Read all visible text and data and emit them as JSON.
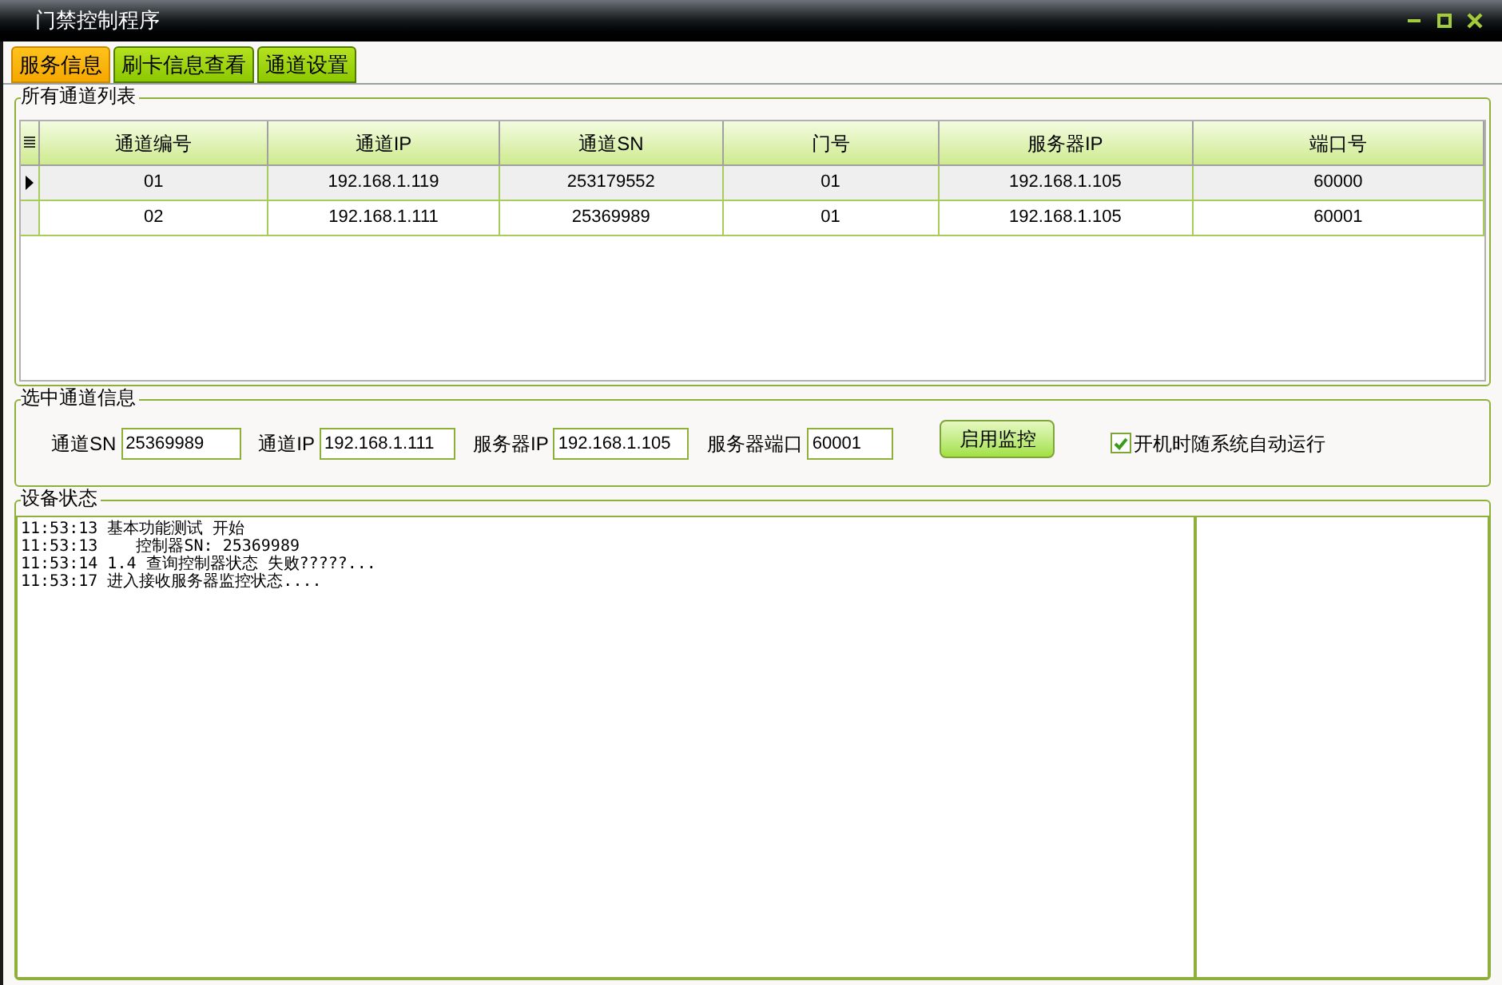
{
  "window": {
    "title": "门禁控制程序"
  },
  "tabs": [
    {
      "label": "服务信息",
      "selected": true
    },
    {
      "label": "刷卡信息查看",
      "selected": false
    },
    {
      "label": "通道设置",
      "selected": false
    }
  ],
  "channel_list": {
    "title": "所有通道列表",
    "columns": [
      "通道编号",
      "通道IP",
      "通道SN",
      "门号",
      "服务器IP",
      "端口号"
    ],
    "rows": [
      {
        "selected": true,
        "cells": [
          "01",
          "192.168.1.119",
          "253179552",
          "01",
          "192.168.1.105",
          "60000"
        ]
      },
      {
        "selected": false,
        "cells": [
          "02",
          "192.168.1.111",
          "25369989",
          "01",
          "192.168.1.105",
          "60001"
        ]
      }
    ]
  },
  "selected_channel": {
    "title": "选中通道信息",
    "fields": [
      {
        "label": "通道SN",
        "value": "25369989"
      },
      {
        "label": "通道IP",
        "value": "192.168.1.111"
      },
      {
        "label": "服务器IP",
        "value": "192.168.1.105"
      },
      {
        "label": "服务器端口",
        "value": "60001"
      }
    ],
    "button": "启用监控",
    "autostart": {
      "label": "开机时随系统自动运行",
      "checked": true
    }
  },
  "device_status": {
    "title": "设备状态",
    "log": [
      "11:53:13 基本功能测试 开始",
      "11:53:13    控制器SN: 25369989",
      "11:53:14 1.4 查询控制器状态 失败?????...",
      "11:53:17 进入接收服务器监控状态...."
    ]
  }
}
